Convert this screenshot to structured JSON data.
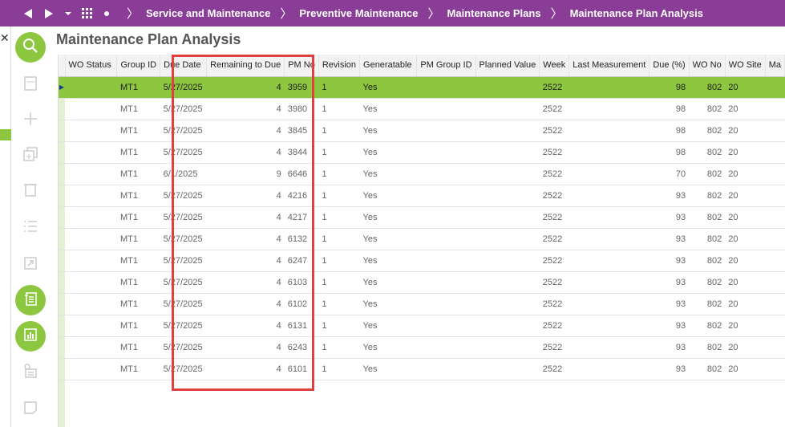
{
  "breadcrumb": [
    "Service and Maintenance",
    "Preventive Maintenance",
    "Maintenance Plans",
    "Maintenance Plan Analysis"
  ],
  "page_title": "Maintenance Plan Analysis",
  "close_label": "✕",
  "columns": [
    "WO Status",
    "Group ID",
    "Due Date",
    "Remaining to Due",
    "PM No",
    "Revision",
    "Generatable",
    "PM Group ID",
    "Planned Value",
    "Week",
    "Last Measurement",
    "Due (%)",
    "WO No",
    "WO Site",
    "Ma"
  ],
  "rows": [
    {
      "wo_status": "",
      "group_id": "MT1",
      "due_date": "5/27/2025",
      "remaining": "4",
      "pm_no": "3959",
      "revision": "1",
      "generatable": "Yes",
      "pm_group_id": "",
      "planned_value": "",
      "week": "2522",
      "last_measurement": "",
      "due_pct": "98",
      "wo_no": "802",
      "wo_site": "20"
    },
    {
      "wo_status": "",
      "group_id": "MT1",
      "due_date": "5/27/2025",
      "remaining": "4",
      "pm_no": "3980",
      "revision": "1",
      "generatable": "Yes",
      "pm_group_id": "",
      "planned_value": "",
      "week": "2522",
      "last_measurement": "",
      "due_pct": "98",
      "wo_no": "802",
      "wo_site": "20"
    },
    {
      "wo_status": "",
      "group_id": "MT1",
      "due_date": "5/27/2025",
      "remaining": "4",
      "pm_no": "3845",
      "revision": "1",
      "generatable": "Yes",
      "pm_group_id": "",
      "planned_value": "",
      "week": "2522",
      "last_measurement": "",
      "due_pct": "98",
      "wo_no": "802",
      "wo_site": "20"
    },
    {
      "wo_status": "",
      "group_id": "MT1",
      "due_date": "5/27/2025",
      "remaining": "4",
      "pm_no": "3844",
      "revision": "1",
      "generatable": "Yes",
      "pm_group_id": "",
      "planned_value": "",
      "week": "2522",
      "last_measurement": "",
      "due_pct": "98",
      "wo_no": "802",
      "wo_site": "20"
    },
    {
      "wo_status": "",
      "group_id": "MT1",
      "due_date": "6/1/2025",
      "remaining": "9",
      "pm_no": "6646",
      "revision": "1",
      "generatable": "Yes",
      "pm_group_id": "",
      "planned_value": "",
      "week": "2522",
      "last_measurement": "",
      "due_pct": "70",
      "wo_no": "802",
      "wo_site": "20"
    },
    {
      "wo_status": "",
      "group_id": "MT1",
      "due_date": "5/27/2025",
      "remaining": "4",
      "pm_no": "4216",
      "revision": "1",
      "generatable": "Yes",
      "pm_group_id": "",
      "planned_value": "",
      "week": "2522",
      "last_measurement": "",
      "due_pct": "93",
      "wo_no": "802",
      "wo_site": "20"
    },
    {
      "wo_status": "",
      "group_id": "MT1",
      "due_date": "5/27/2025",
      "remaining": "4",
      "pm_no": "4217",
      "revision": "1",
      "generatable": "Yes",
      "pm_group_id": "",
      "planned_value": "",
      "week": "2522",
      "last_measurement": "",
      "due_pct": "93",
      "wo_no": "802",
      "wo_site": "20"
    },
    {
      "wo_status": "",
      "group_id": "MT1",
      "due_date": "5/27/2025",
      "remaining": "4",
      "pm_no": "6132",
      "revision": "1",
      "generatable": "Yes",
      "pm_group_id": "",
      "planned_value": "",
      "week": "2522",
      "last_measurement": "",
      "due_pct": "93",
      "wo_no": "802",
      "wo_site": "20"
    },
    {
      "wo_status": "",
      "group_id": "MT1",
      "due_date": "5/27/2025",
      "remaining": "4",
      "pm_no": "6247",
      "revision": "1",
      "generatable": "Yes",
      "pm_group_id": "",
      "planned_value": "",
      "week": "2522",
      "last_measurement": "",
      "due_pct": "93",
      "wo_no": "802",
      "wo_site": "20"
    },
    {
      "wo_status": "",
      "group_id": "MT1",
      "due_date": "5/27/2025",
      "remaining": "4",
      "pm_no": "6103",
      "revision": "1",
      "generatable": "Yes",
      "pm_group_id": "",
      "planned_value": "",
      "week": "2522",
      "last_measurement": "",
      "due_pct": "93",
      "wo_no": "802",
      "wo_site": "20"
    },
    {
      "wo_status": "",
      "group_id": "MT1",
      "due_date": "5/27/2025",
      "remaining": "4",
      "pm_no": "6102",
      "revision": "1",
      "generatable": "Yes",
      "pm_group_id": "",
      "planned_value": "",
      "week": "2522",
      "last_measurement": "",
      "due_pct": "93",
      "wo_no": "802",
      "wo_site": "20"
    },
    {
      "wo_status": "",
      "group_id": "MT1",
      "due_date": "5/27/2025",
      "remaining": "4",
      "pm_no": "6131",
      "revision": "1",
      "generatable": "Yes",
      "pm_group_id": "",
      "planned_value": "",
      "week": "2522",
      "last_measurement": "",
      "due_pct": "93",
      "wo_no": "802",
      "wo_site": "20"
    },
    {
      "wo_status": "",
      "group_id": "MT1",
      "due_date": "5/27/2025",
      "remaining": "4",
      "pm_no": "6243",
      "revision": "1",
      "generatable": "Yes",
      "pm_group_id": "",
      "planned_value": "",
      "week": "2522",
      "last_measurement": "",
      "due_pct": "93",
      "wo_no": "802",
      "wo_site": "20"
    },
    {
      "wo_status": "",
      "group_id": "MT1",
      "due_date": "5/27/2025",
      "remaining": "4",
      "pm_no": "6101",
      "revision": "1",
      "generatable": "Yes",
      "pm_group_id": "",
      "planned_value": "",
      "week": "2522",
      "last_measurement": "",
      "due_pct": "93",
      "wo_no": "802",
      "wo_site": "20"
    }
  ],
  "active_row_marker": "▶",
  "colors": {
    "topbar": "#8a3d96",
    "accent": "#8dc63f",
    "highlight": "#e04040"
  },
  "icons": [
    "back-arrow-icon",
    "forward-arrow-icon",
    "dropdown-caret-icon",
    "app-grid-icon",
    "dot-icon",
    "search-icon",
    "view-icon",
    "add-icon",
    "duplicate-icon",
    "delete-icon",
    "list-icon",
    "expand-icon",
    "details-icon",
    "analysis-chart-icon",
    "info-list-icon",
    "note-icon"
  ]
}
